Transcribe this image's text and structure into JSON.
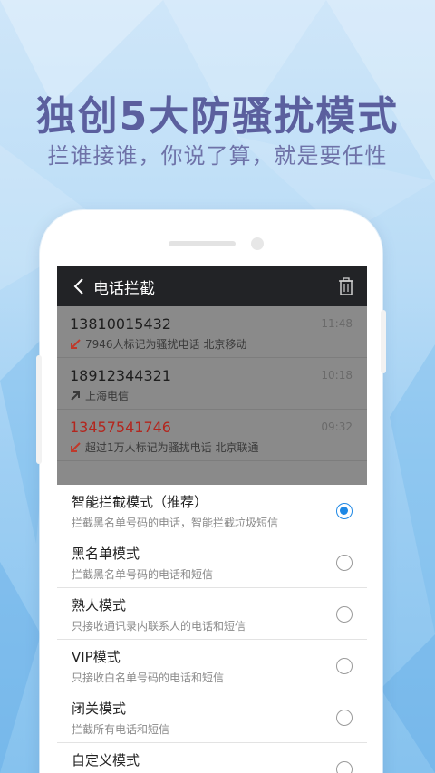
{
  "hero": {
    "title": "独创5大防骚扰模式",
    "subtitle": "拦谁接谁，你说了算，就是要任性"
  },
  "screen": {
    "topbar": {
      "back_icon": "chevron-left-icon",
      "title": "电话拦截",
      "trash_icon": "trash-icon"
    },
    "calls": [
      {
        "number": "13810015432",
        "time": "11:48",
        "direction": "incoming-blocked",
        "info": "7946人标记为骚扰电话  北京移动",
        "number_color": "#1f1f1f"
      },
      {
        "number": "18912344321",
        "time": "10:18",
        "direction": "outgoing",
        "info": "上海电信",
        "number_color": "#1f1f1f"
      },
      {
        "number": "13457541746",
        "time": "09:32",
        "direction": "incoming-blocked",
        "info": "超过1万人标记为骚扰电话  北京联通",
        "number_color": "#b3261e"
      }
    ],
    "modes": [
      {
        "title": "智能拦截模式（推荐）",
        "desc": "拦截黑名单号码的电话，智能拦截垃圾短信",
        "selected": true
      },
      {
        "title": "黑名单模式",
        "desc": "拦截黑名单号码的电话和短信",
        "selected": false
      },
      {
        "title": "熟人模式",
        "desc": "只接收通讯录内联系人的电话和短信",
        "selected": false
      },
      {
        "title": "VIP模式",
        "desc": "只接收白名单号码的电话和短信",
        "selected": false
      },
      {
        "title": "闭关模式",
        "desc": "拦截所有电话和短信",
        "selected": false
      },
      {
        "title": "自定义模式",
        "desc": "",
        "selected": false
      }
    ]
  },
  "colors": {
    "accent": "#1e88e5",
    "headline": "#5b5f9e",
    "blocked_arrow": "#c0392b"
  }
}
